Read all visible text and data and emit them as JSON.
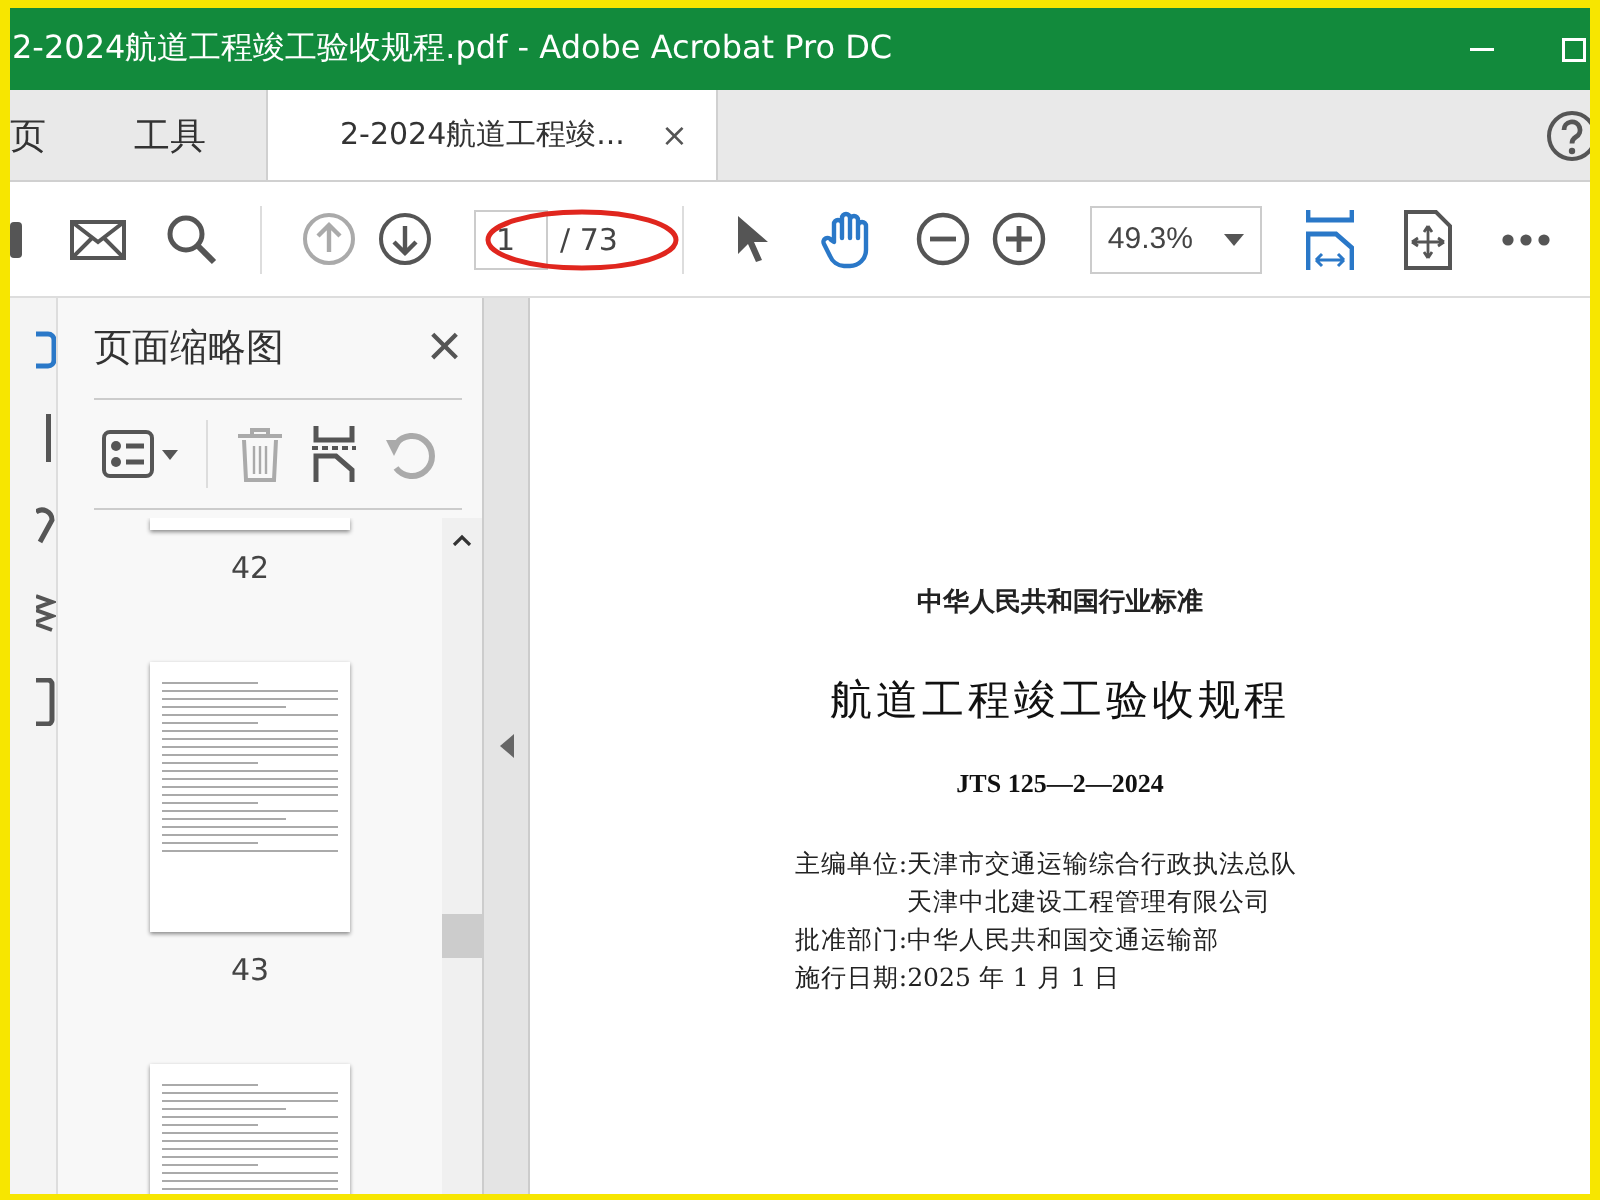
{
  "window": {
    "title": "2-2024航道工程竣工验收规程.pdf - Adobe Acrobat Pro DC"
  },
  "tabs": [
    {
      "label": "页",
      "kind": "nav",
      "selected": false
    },
    {
      "label": "工具",
      "kind": "nav",
      "selected": false
    },
    {
      "label": "2-2024航道工程竣...",
      "kind": "document",
      "selected": true,
      "close": "×"
    }
  ],
  "toolbar": {
    "page_number": "1",
    "page_total": "/ 73",
    "zoom": "49.3%"
  },
  "thumbnails_panel": {
    "title": "页面缩略图",
    "close": "×",
    "pages": [
      {
        "label": "42"
      },
      {
        "label": "43"
      }
    ]
  },
  "document": {
    "lines": [
      {
        "kind": "heading",
        "text": "中华人民共和国行业标准"
      },
      {
        "kind": "title",
        "text": "航道工程竣工验收规程"
      },
      {
        "kind": "code",
        "text": "JTS 125—2—2024"
      },
      {
        "kind": "field",
        "label": "主编单位:",
        "values": [
          "天津市交通运输综合行政执法总队",
          "天津中北建设工程管理有限公司"
        ]
      },
      {
        "kind": "field",
        "label": "批准部门:",
        "values": [
          "中华人民共和国交通运输部"
        ]
      },
      {
        "kind": "field",
        "label": "施行日期:",
        "values": [
          "2025 年 1 月 1 日"
        ]
      }
    ]
  }
}
